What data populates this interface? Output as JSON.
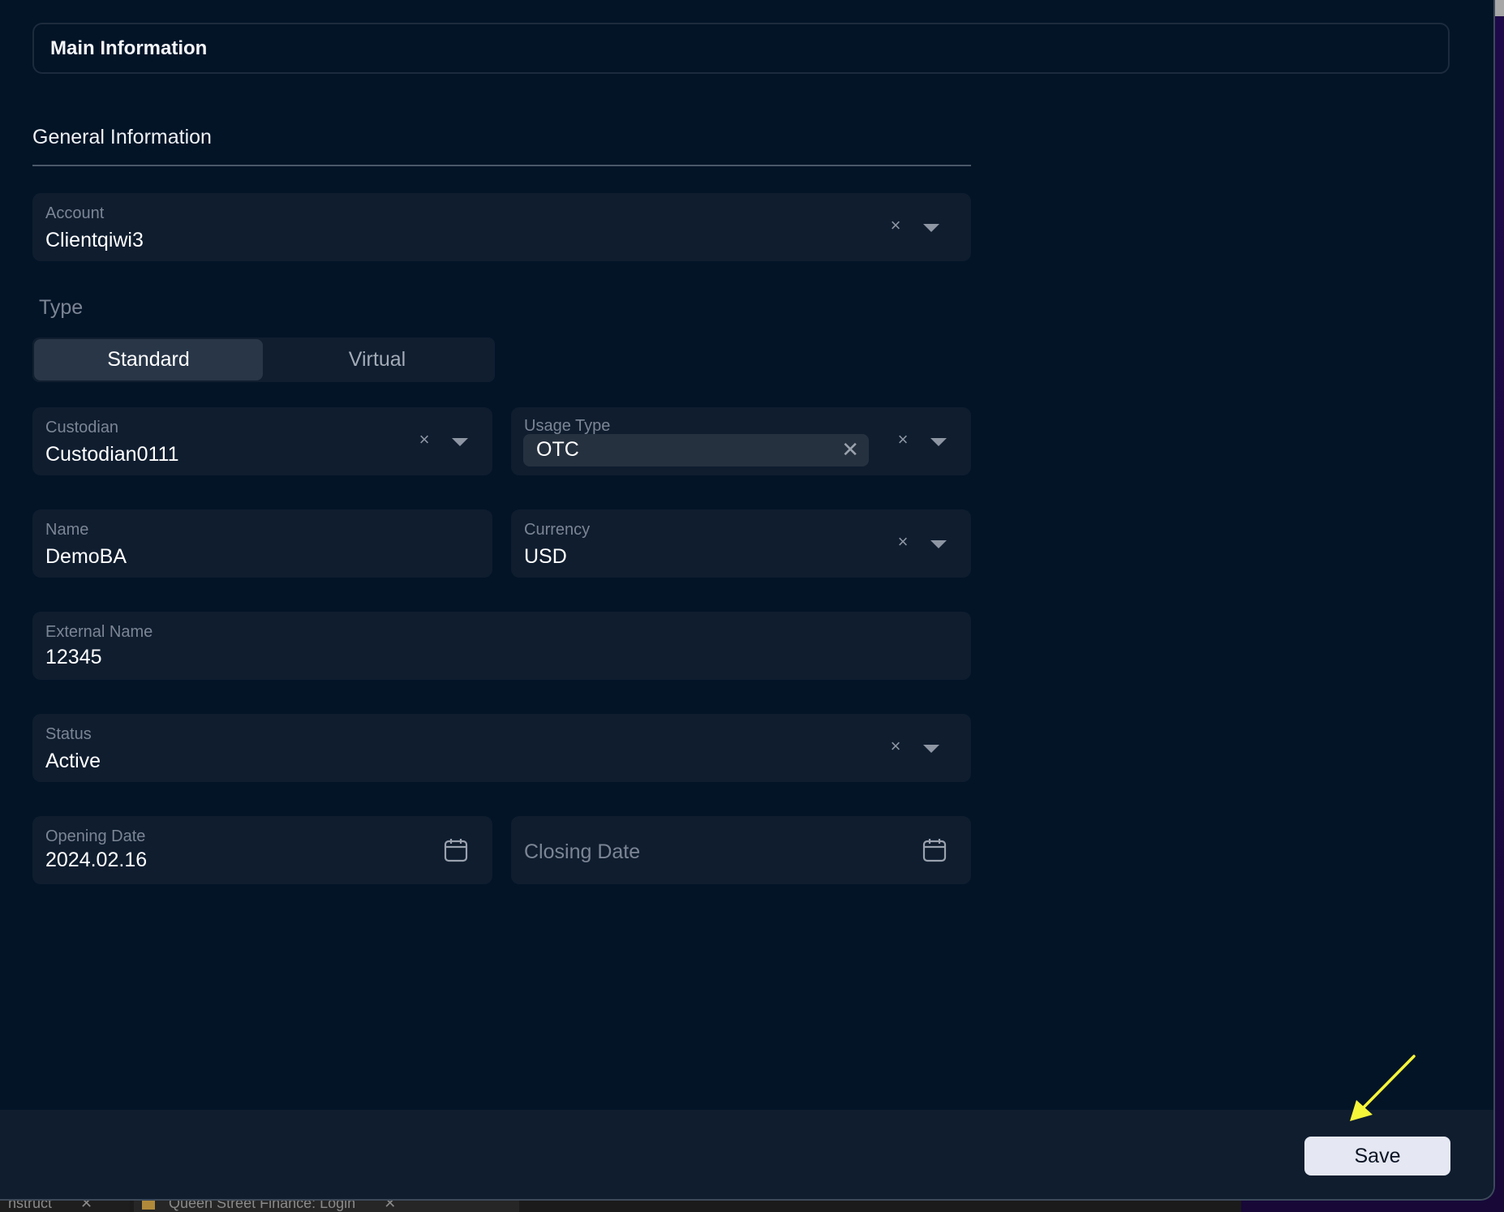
{
  "header": {
    "title": "Main Information"
  },
  "section": {
    "title": "General Information"
  },
  "fields": {
    "account": {
      "label": "Account",
      "value": "Clientqiwi3"
    },
    "type": {
      "label": "Type",
      "options": [
        "Standard",
        "Virtual"
      ],
      "selected": "Standard"
    },
    "custodian": {
      "label": "Custodian",
      "value": "Custodian0111"
    },
    "usage_type": {
      "label": "Usage Type",
      "chips": [
        "OTC"
      ]
    },
    "name": {
      "label": "Name",
      "value": "DemoBA"
    },
    "currency": {
      "label": "Currency",
      "value": "USD"
    },
    "external_name": {
      "label": "External Name",
      "value": "12345"
    },
    "status": {
      "label": "Status",
      "value": "Active"
    },
    "opening_date": {
      "label": "Opening Date",
      "value": "2024.02.16"
    },
    "closing_date": {
      "placeholder": "Closing Date"
    }
  },
  "icons": {
    "clear": "×",
    "chip_remove": "✕"
  },
  "footer": {
    "save_label": "Save"
  },
  "browser_tabs": [
    {
      "label": "nstruct"
    },
    {
      "label": "Queen Street Finance: Login"
    }
  ],
  "colors": {
    "background": "#031427",
    "field_bg": "#0f1d2f",
    "annotation_arrow": "#f5f53a",
    "save_button_bg": "#e5e8f2"
  }
}
